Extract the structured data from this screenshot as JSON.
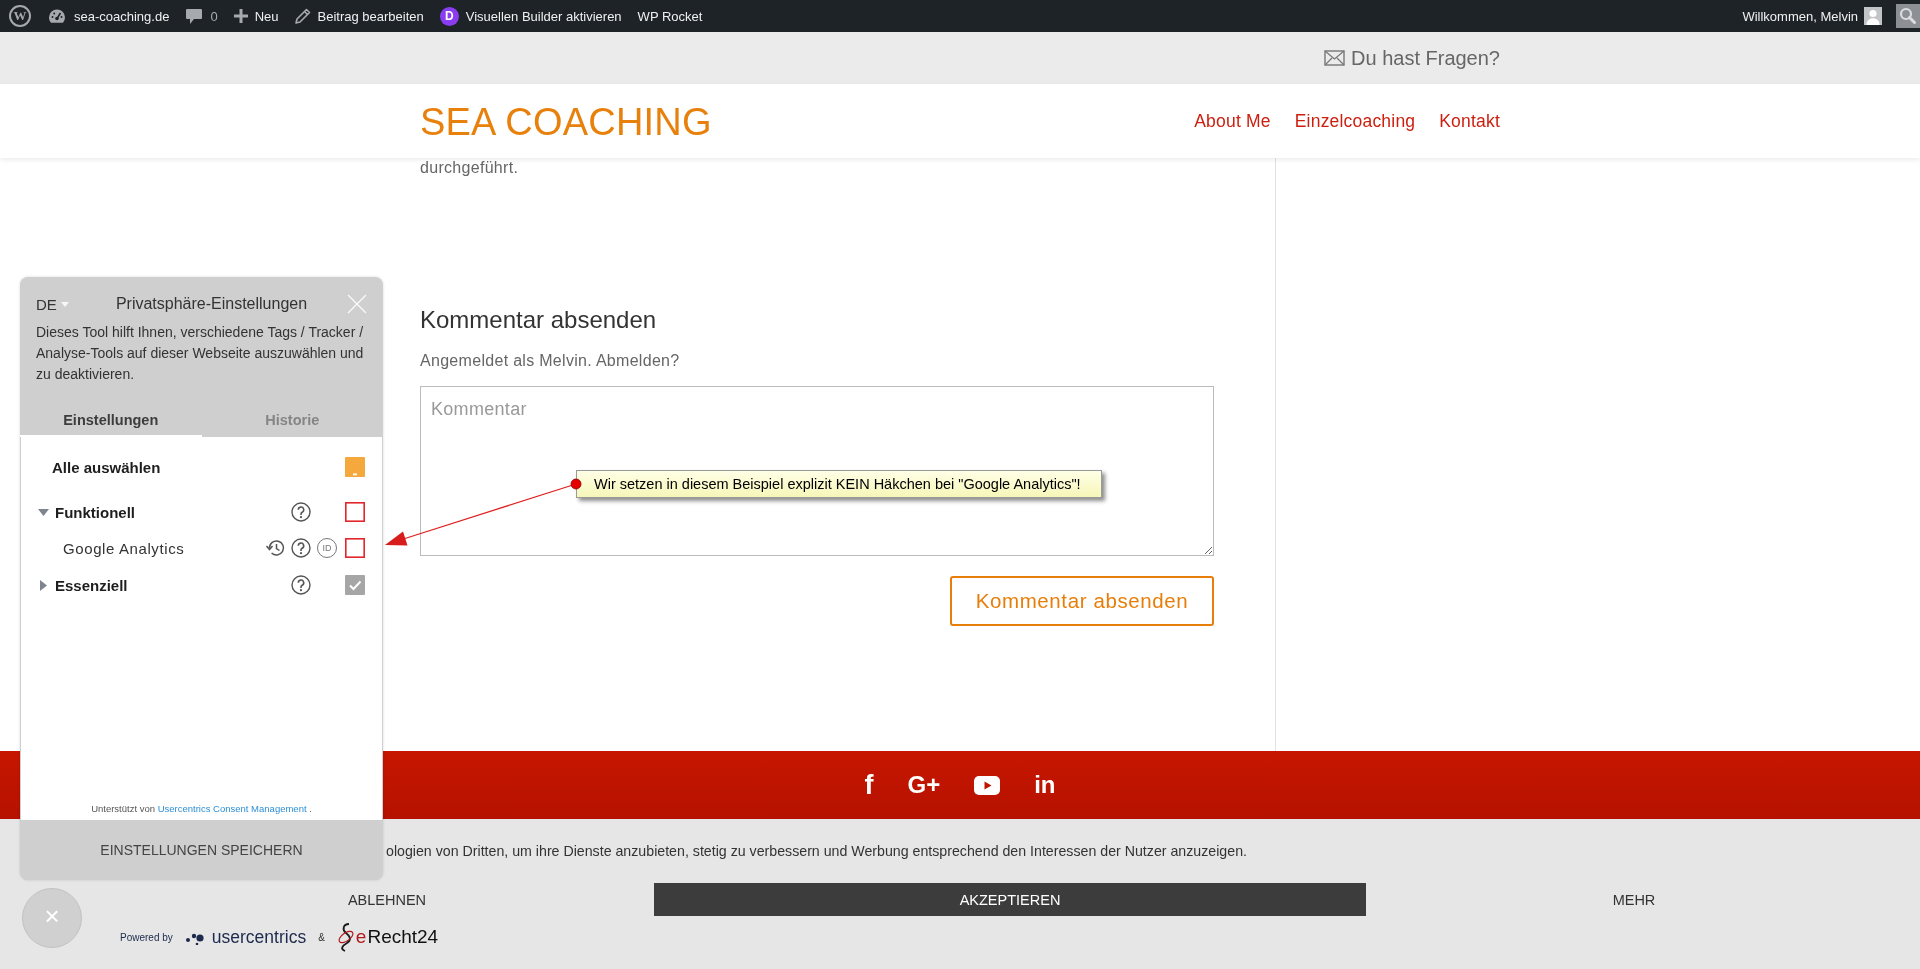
{
  "adminbar": {
    "logo": "W",
    "items": [
      {
        "kind": "site",
        "label": "sea-coaching.de"
      },
      {
        "kind": "comments",
        "label": "0"
      },
      {
        "kind": "new",
        "label": "Neu"
      },
      {
        "kind": "edit",
        "label": "Beitrag bearbeiten"
      },
      {
        "kind": "builder",
        "badge": "D",
        "label": "Visuellen Builder aktivieren"
      },
      {
        "kind": "plain",
        "label": "WP Rocket"
      }
    ],
    "greeting": "Willkommen, Melvin"
  },
  "topbar": {
    "contact": "Du hast Fragen?"
  },
  "header": {
    "logo": "SEA COACHING",
    "nav": [
      "About Me",
      "Einzelcoaching",
      "Kontakt"
    ]
  },
  "content": {
    "text_fragment": "durchgeführt.",
    "comment_form": {
      "heading": "Kommentar absenden",
      "logged_in": "Angemeldet als Melvin. Abmelden?",
      "placeholder": "Kommentar",
      "submit": "Kommentar absenden"
    }
  },
  "annotation": {
    "text": "Wir setzen in diesem Beispiel explizit KEIN Häkchen bei \"Google Analytics\"!"
  },
  "footer": {
    "social": [
      {
        "kind": "glyph",
        "glyph": "f"
      },
      {
        "kind": "glyph",
        "glyph": "G+"
      },
      {
        "kind": "video"
      },
      {
        "kind": "glyph",
        "glyph": "in"
      }
    ]
  },
  "cookie_banner": {
    "text": "ologien von Dritten, um ihre Dienste anzubieten, stetig zu verbessern und Werbung entsprechend den Interessen der Nutzer anzuzeigen.",
    "buttons": [
      {
        "kind": "plain",
        "label": "ABLEHNEN"
      },
      {
        "kind": "primary",
        "label": "AKZEPTIEREN"
      },
      {
        "kind": "plain",
        "label": "MEHR"
      }
    ],
    "powered_by": "Powered by",
    "partners": [
      {
        "kind": "dots",
        "name": "usercentrics"
      },
      {
        "kind": "swirl",
        "name": "eRecht24"
      }
    ],
    "separator": "&",
    "close": "×"
  },
  "privacy_panel": {
    "language": "DE",
    "title": "Privatsphäre-Einstellungen",
    "description": "Dieses Tool hilft Ihnen, verschiedene Tags / Tracker / Analyse-Tools auf dieser Webseite auszuwählen und zu deaktivieren.",
    "tabs": [
      {
        "label": "Einstellungen",
        "selected": true
      },
      {
        "label": "Historie",
        "selected": false
      }
    ],
    "select_all": {
      "label": "Alle auswählen",
      "indeterminate": true
    },
    "categories": [
      {
        "label": "Funktionell",
        "expanded": true,
        "checked": false,
        "disabled": false,
        "children": [
          {
            "label": "Google Analytics",
            "id_label": "ID",
            "checked": false
          }
        ]
      },
      {
        "label": "Essenziell",
        "expanded": false,
        "checked": true,
        "disabled": true
      }
    ],
    "footer": {
      "prefix": "Unterstützt von",
      "link": "Usercentrics Consent Management",
      "suffix": "."
    },
    "save_button": "EINSTELLUNGEN SPEICHERN"
  }
}
